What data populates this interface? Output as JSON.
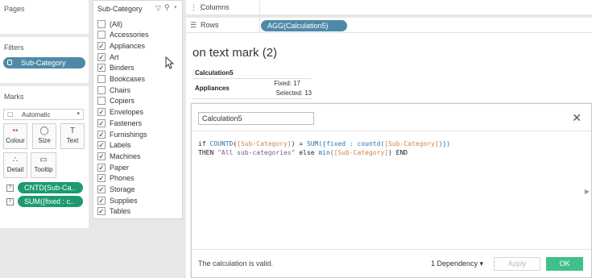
{
  "pages": {
    "title": "Pages"
  },
  "filters": {
    "title": "Filters",
    "pill": "Sub-Category"
  },
  "marks": {
    "title": "Marks",
    "type": "Automatic",
    "buttons": [
      "Colour",
      "Size",
      "Text",
      "Detail",
      "Tooltip"
    ],
    "fields": [
      "CNTD(Sub-Ca..",
      "SUM({fixed : c.."
    ]
  },
  "subcategory_filter": {
    "title": "Sub-Category",
    "items": [
      {
        "label": "(All)",
        "checked": false
      },
      {
        "label": "Accessories",
        "checked": false
      },
      {
        "label": "Appliances",
        "checked": true
      },
      {
        "label": "Art",
        "checked": true
      },
      {
        "label": "Binders",
        "checked": true
      },
      {
        "label": "Bookcases",
        "checked": false
      },
      {
        "label": "Chairs",
        "checked": false
      },
      {
        "label": "Copiers",
        "checked": false
      },
      {
        "label": "Envelopes",
        "checked": true
      },
      {
        "label": "Fasteners",
        "checked": true
      },
      {
        "label": "Furnishings",
        "checked": true
      },
      {
        "label": "Labels",
        "checked": true
      },
      {
        "label": "Machines",
        "checked": true
      },
      {
        "label": "Paper",
        "checked": true
      },
      {
        "label": "Phones",
        "checked": true
      },
      {
        "label": "Storage",
        "checked": true
      },
      {
        "label": "Supplies",
        "checked": true
      },
      {
        "label": "Tables",
        "checked": true
      }
    ]
  },
  "shelves": {
    "columns_label": "Columns",
    "rows_label": "Rows",
    "rows_pill": "AGG(Calculation5)"
  },
  "view": {
    "title": "on text mark (2)",
    "header": "Calculation5",
    "row_label": "Appliances",
    "line1": "Fixed: 17",
    "line2": "Selected: 13"
  },
  "calc_dialog": {
    "name": "Calculation5",
    "status": "The calculation is valid.",
    "dependency": "1 Dependency ▾",
    "apply_label": "Apply",
    "ok_label": "OK",
    "code_line1_a": "if ",
    "code_line1_b": "COUNTD",
    "code_line1_c": "(",
    "code_line1_d": "[Sub-Category]",
    "code_line1_e": ") = ",
    "code_line1_f": "SUM",
    "code_line1_g": "({fixed : countd(",
    "code_line1_h": "[Sub-Category]",
    "code_line1_i": ")})",
    "code_line2_a": "THEN ",
    "code_line2_b": "\"All sub-categories\"",
    "code_line2_c": " else ",
    "code_line2_d": "min(",
    "code_line2_e": "[Sub-Category]",
    "code_line2_f": ") END"
  }
}
